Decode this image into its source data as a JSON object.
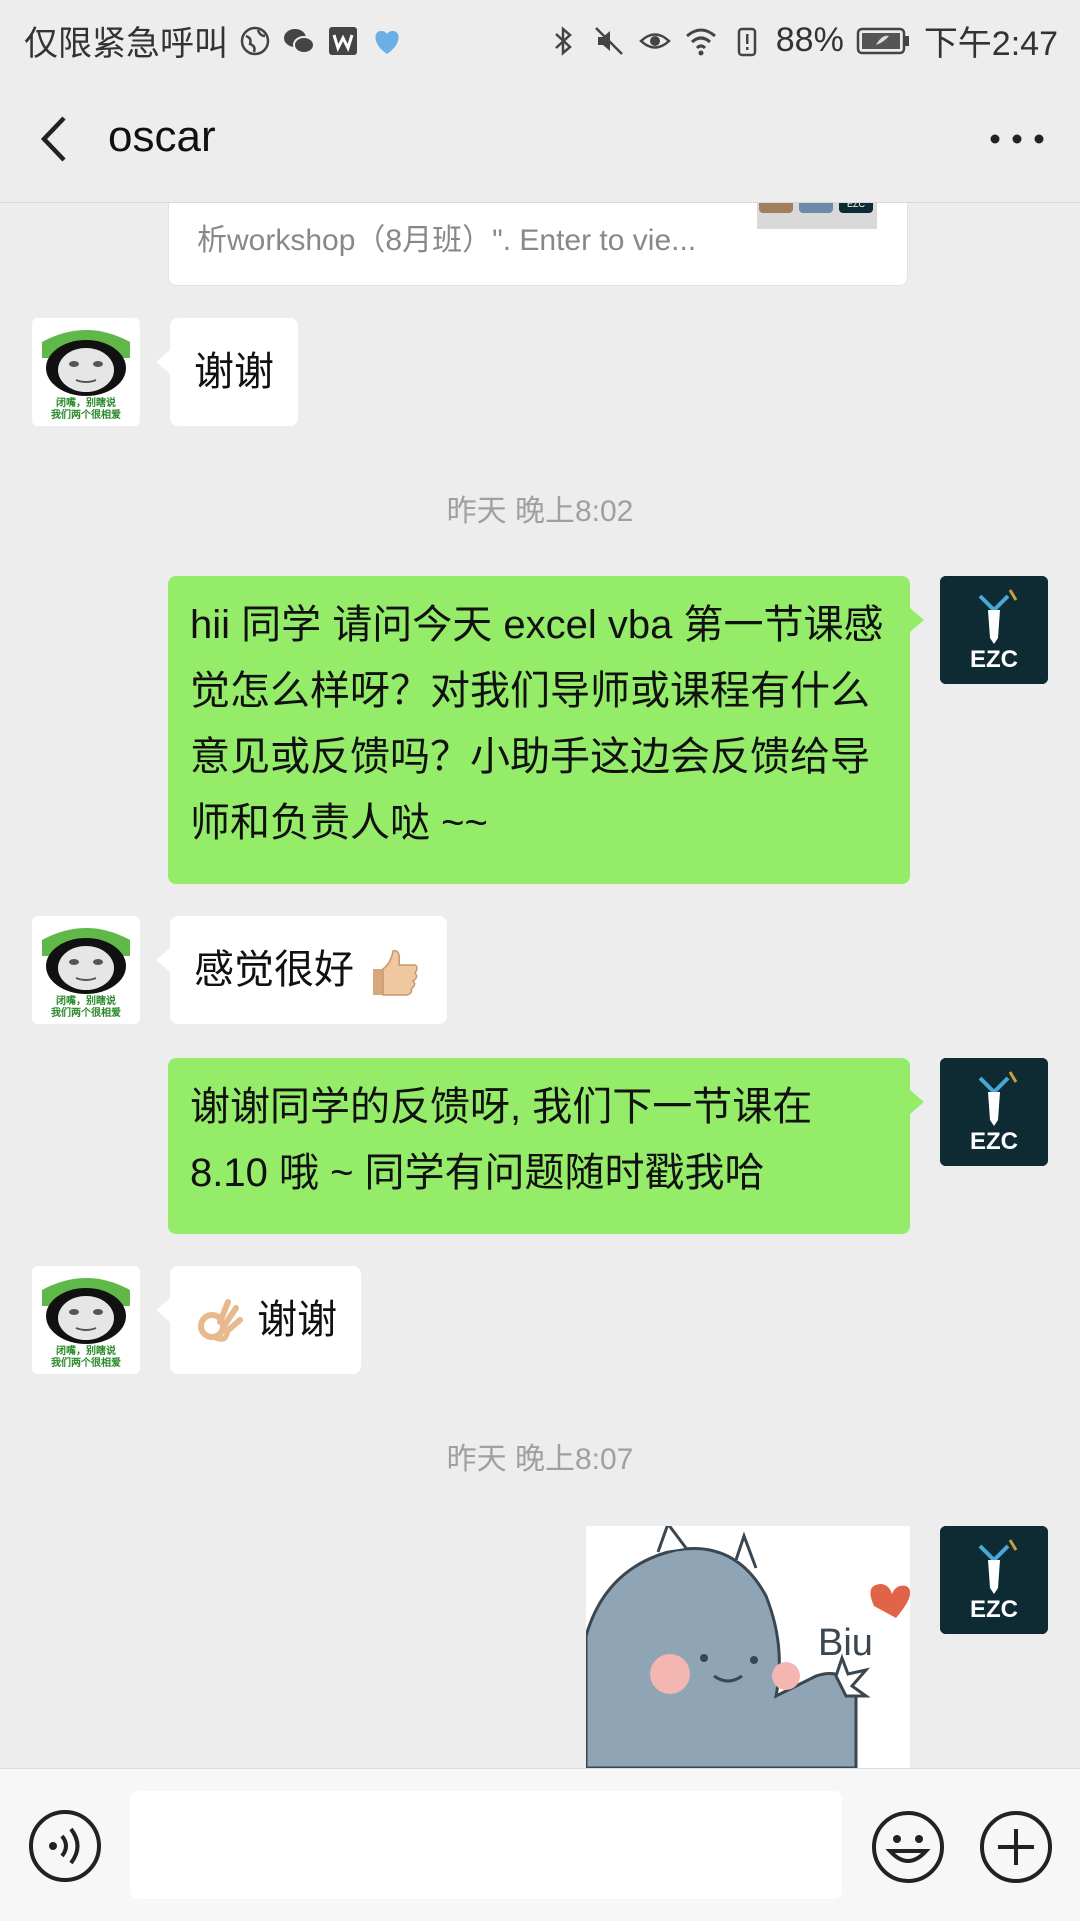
{
  "status_bar": {
    "carrier_text": "仅限紧急呼叫",
    "battery_percent": "88%",
    "time": "下午2:47"
  },
  "nav": {
    "title": "oscar"
  },
  "messages": {
    "link_card_desc": "析workshop（8月班）\". Enter to vie...",
    "thumb_logo_text": "EZC",
    "msg1": "谢谢",
    "ts1": "昨天 晚上8:02",
    "msg2": "hii 同学 请问今天 excel vba 第一节课感觉怎么样呀？对我们导师或课程有什么意见或反馈吗？小助手这边会反馈给导师和负责人哒 ~~",
    "msg3": "感觉很好",
    "msg4": "谢谢同学的反馈呀, 我们下一节课在8.10 哦 ~ 同学有问题随时戳我哈",
    "msg5": "谢谢",
    "ts2": "昨天 晚上8:07",
    "sticker_text": "Biu"
  },
  "avatars": {
    "panda_caption_line1": "闭嘴，别瞎说",
    "panda_caption_line2": "我们两个很相爱",
    "ezc_label": "EZC"
  },
  "input": {
    "placeholder": ""
  },
  "colors": {
    "background": "#ededed",
    "outgoing_bubble": "#95ec69",
    "incoming_bubble": "#ffffff",
    "ezc_avatar_bg": "#0e2b33"
  },
  "icons": {
    "back": "chevron-left-icon",
    "more": "more-dots-icon",
    "voice": "voice-icon",
    "emoji": "emoji-icon",
    "plus": "plus-icon"
  }
}
